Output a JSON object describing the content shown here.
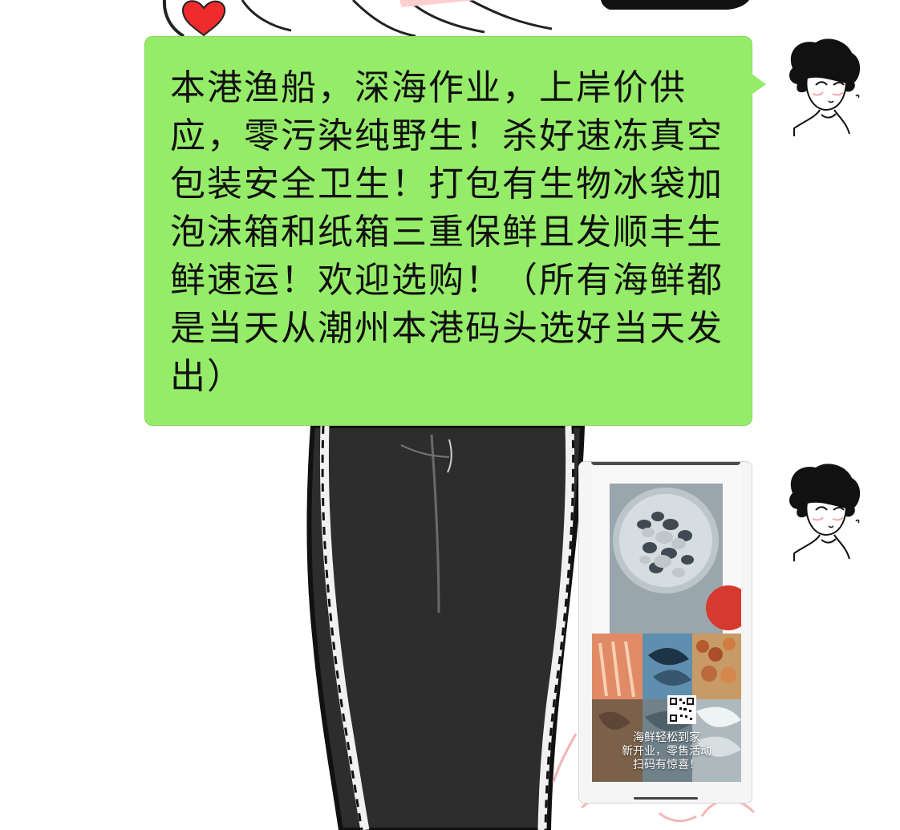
{
  "chat": {
    "messages": [
      {
        "type": "text",
        "sender": "self",
        "content": "本港渔船，深海作业，上岸价供应，零污染纯野生！杀好速冻真空包装安全卫生！打包有生物冰袋加泡沫箱和纸箱三重保鲜且发顺丰生鲜速运！欢迎选购！（所有海鲜都是当天从潮州本港码头选好当天发出）",
        "bubble_color": "#95ec69"
      },
      {
        "type": "image",
        "sender": "self",
        "overlay_lines": [
          "海鲜轻松到家",
          "新开业，零售活动",
          "扫码有惊喜！"
        ]
      }
    ]
  },
  "ui": {
    "avatar_icon": "cartoon-boy-avatar-icon",
    "background_art": "cartoon-character-wallpaper",
    "accent": "#95ec69",
    "background": "#ffffff"
  }
}
